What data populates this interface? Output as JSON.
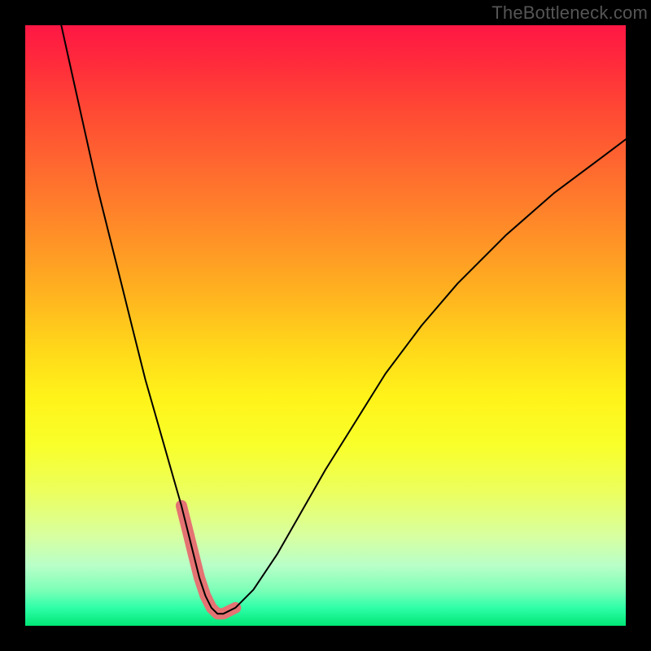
{
  "watermark": "TheBottleneck.com",
  "chart_data": {
    "type": "line",
    "title": "",
    "xlabel": "",
    "ylabel": "",
    "xlim": [
      0,
      100
    ],
    "ylim": [
      0,
      100
    ],
    "grid": false,
    "series": [
      {
        "name": "bottleneck-curve",
        "x": [
          6,
          8,
          10,
          12,
          14,
          16,
          18,
          20,
          22,
          24,
          26,
          27,
          28,
          29,
          30,
          31,
          32,
          33,
          35,
          38,
          42,
          46,
          50,
          55,
          60,
          66,
          72,
          80,
          88,
          96,
          100
        ],
        "values": [
          100,
          91,
          82,
          73,
          65,
          57,
          49,
          41,
          34,
          27,
          20,
          16,
          12,
          8,
          5,
          3,
          2,
          2,
          3,
          6,
          12,
          19,
          26,
          34,
          42,
          50,
          57,
          65,
          72,
          78,
          81
        ],
        "color": "#000000",
        "width": 2
      },
      {
        "name": "highlight-band",
        "x": [
          26,
          27,
          28,
          29,
          30,
          31,
          32,
          33,
          35
        ],
        "values": [
          20,
          16,
          12,
          8,
          5,
          3,
          2,
          2,
          3
        ],
        "color": "#e57373",
        "width": 14
      }
    ],
    "background_gradient": {
      "top": "#ff1744",
      "mid": "#ffe600",
      "bottom": "#00e676"
    }
  }
}
